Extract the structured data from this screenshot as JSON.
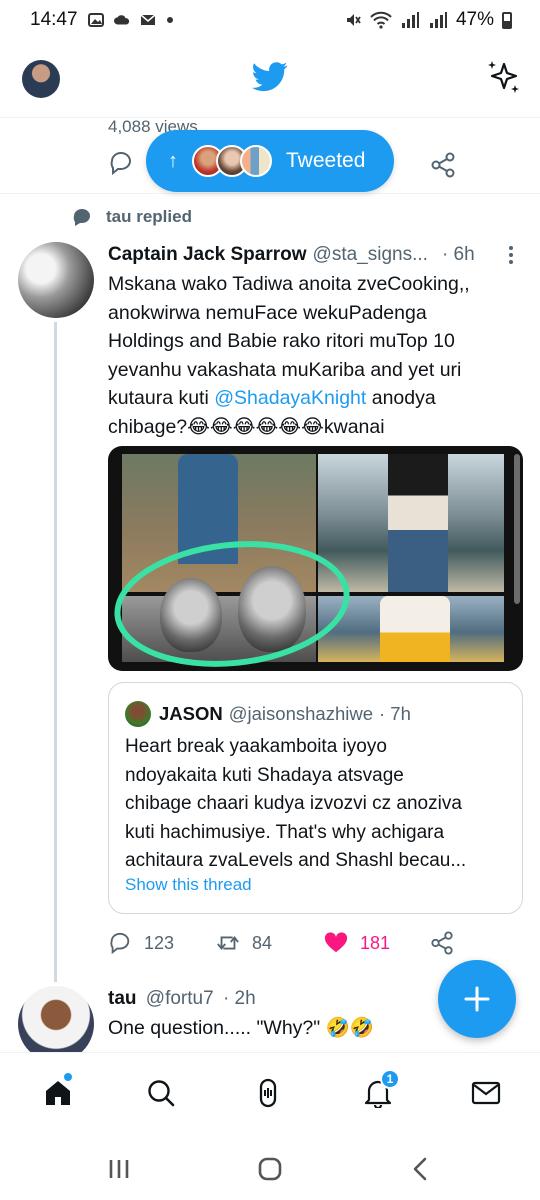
{
  "status_bar": {
    "time": "14:47",
    "battery": "47%"
  },
  "icons": {
    "twitter": "twitter-bird-icon",
    "sparkle": "sparkle-icon"
  },
  "partial_tweet": {
    "views": "4,088 views"
  },
  "tweeted_pill": {
    "label": "Tweeted"
  },
  "thread": {
    "context": "tau replied",
    "tweet": {
      "author": "Captain Jack Sparrow",
      "handle": "@sta_signs...",
      "time": "· 6h",
      "text_lines": [
        "Mskana wako Tadiwa anoita zveCooking,,",
        "anokwirwa nemuFace wekuPadenga",
        "Holdings and Babie rako ritori muTop 10",
        "yevanhu vakashata muKariba and yet uri"
      ],
      "text_line5_pre": "kutaura kuti ",
      "mention": "@ShadayaKnight",
      "text_line5_post": " anodya",
      "text_line6": "chibage?😂😂😂😂😂😂kwanai"
    },
    "quote": {
      "author": "JASON",
      "handle": "@jaisonshazhiwe",
      "time": "· 7h",
      "lines": [
        "Heart break yaakamboita  iyoyo",
        "ndoyakaita kuti Shadaya atsvage",
        "chibage chaari kudya izvozvi cz anoziva",
        "kuti hachimusiye. That's why achigara",
        "achitaura zvaLevels and Shashl becau..."
      ],
      "show_thread": "Show this thread"
    },
    "actions": {
      "replies": "123",
      "retweets": "84",
      "likes": "181"
    }
  },
  "next_tweet": {
    "author": "tau",
    "handle": "@fortu7",
    "time": "· 2h",
    "text": "One question..... \"Why?\" 🤣🤣"
  },
  "bottom_nav": {
    "notifications_badge": "1"
  },
  "colors": {
    "accent": "#1d9bf0",
    "like": "#f91880",
    "secondary_text": "#536471",
    "highlight_ring": "#39e2a4"
  }
}
